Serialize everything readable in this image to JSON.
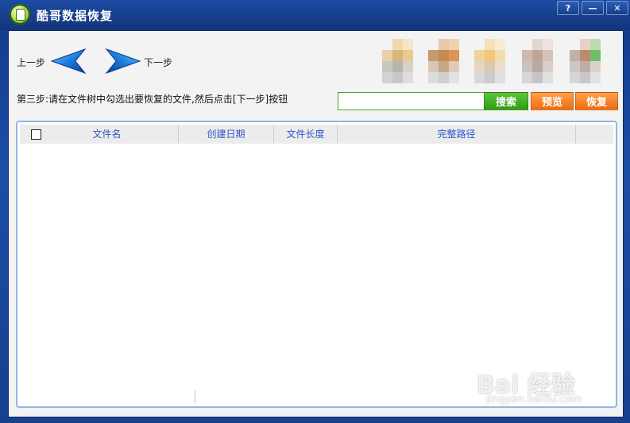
{
  "window": {
    "title": "酷哥数据恢复",
    "buttons": {
      "help": "?",
      "minimize": "—",
      "close": "✕"
    }
  },
  "nav": {
    "prev_label": "上一步",
    "next_label": "下一步"
  },
  "instruction": "第三步:请在文件树中勾选出要恢复的文件,然后点击[下一步]按钮",
  "search": {
    "value": "",
    "placeholder": ""
  },
  "buttons": {
    "search": "搜索",
    "preview": "预览",
    "restore": "恢复"
  },
  "table": {
    "columns": [
      "文件名",
      "创建日期",
      "文件长度",
      "完整路径"
    ],
    "rows": []
  },
  "watermark": {
    "main": "Bai 经验",
    "sub": "jingyan.baidu.com"
  },
  "colors": {
    "title_bar": "#1c4ba3",
    "header_text": "#2a56c4",
    "search_button": "#3faa20",
    "orange_button": "#f07a1c"
  }
}
